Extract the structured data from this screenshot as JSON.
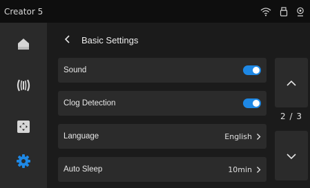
{
  "statusbar": {
    "device_name": "Creator 5",
    "icons": [
      "wifi-icon",
      "usb-drive-icon",
      "webcam-icon"
    ]
  },
  "sidebar": {
    "items": [
      {
        "name": "home",
        "icon": "home-icon",
        "active": false
      },
      {
        "name": "filament",
        "icon": "filament-spool-icon",
        "active": false
      },
      {
        "name": "control",
        "icon": "move-control-icon",
        "active": false
      },
      {
        "name": "settings",
        "icon": "gear-icon",
        "active": true
      }
    ]
  },
  "header": {
    "back_icon": "chevron-left-icon",
    "title": "Basic Settings"
  },
  "settings": {
    "rows": [
      {
        "label": "Sound",
        "type": "toggle",
        "on": true
      },
      {
        "label": "Clog Detection",
        "type": "toggle",
        "on": true
      },
      {
        "label": "Language",
        "type": "select",
        "value": "English"
      },
      {
        "label": "Auto Sleep",
        "type": "select",
        "value": "10min"
      }
    ]
  },
  "pager": {
    "text": "2 / 3",
    "up_icon": "chevron-up-icon",
    "down_icon": "chevron-down-icon"
  },
  "colors": {
    "accent": "#1e88e5",
    "background": "#1b1b1b",
    "panel": "#2b2b2b",
    "sidebar": "#2a2a2a",
    "statusbar": "#0e0e0e"
  }
}
